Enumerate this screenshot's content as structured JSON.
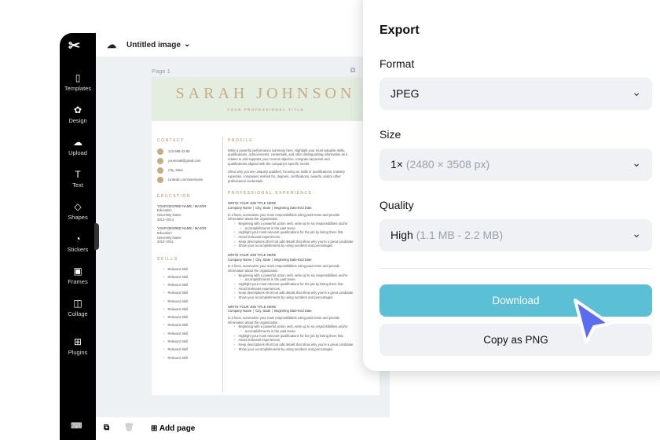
{
  "app": {
    "title": "Untitled image",
    "page_label": "Page 1",
    "add_page": "Add page"
  },
  "sidebar": {
    "items": [
      {
        "label": "Templates",
        "icon": "▯"
      },
      {
        "label": "Design",
        "icon": "✿"
      },
      {
        "label": "Upload",
        "icon": "☁"
      },
      {
        "label": "Text",
        "icon": "T"
      },
      {
        "label": "Shapes",
        "icon": "◇"
      },
      {
        "label": "Stickers",
        "icon": "◔"
      },
      {
        "label": "Frames",
        "icon": "▣"
      },
      {
        "label": "Collage",
        "icon": "◫"
      },
      {
        "label": "Plugins",
        "icon": "⊞"
      }
    ]
  },
  "resume": {
    "name": "SARAH JOHNSON",
    "title": "YOUR PROFESSIONAL TITLE",
    "contact_h": "CONTACT",
    "contact": [
      "123-589-22-88",
      "youremail@gmail.com",
      "City, State",
      "Linkedin.com/username"
    ],
    "education_h": "EDUCATION",
    "education": [
      [
        "YOUR DEGREE NAME / MAJOR",
        "Education",
        "University Name",
        "2012–2014"
      ],
      [
        "YOUR DEGREE NAME / MAJOR",
        "Education",
        "University Name",
        "2010–2011"
      ]
    ],
    "skills_h": "SKILLS",
    "skill": "Relevant Skill",
    "profile_h": "PROFILE",
    "profile": [
      "Write a powerful performance summary here. Highlight your most valuable skills,",
      "qualifications, achievements, credentials, and other distinguishing information as it",
      "relates to and supports your current objective. Integrate keywords and",
      "qualifications aligned with the company's specific needs.",
      "",
      "Show why you are uniquely qualified, focusing on skills or qualifications, industry",
      "expertise, companies worked for, degrees, certifications, awards, and/or other",
      "professional credentials."
    ],
    "exp_h": "PROFESSIONAL EXPERIENCE",
    "job_title": "WRITE YOUR JOB TITLE HERE",
    "job_company": "Company Name │ City, State │ Beginning Date-End Date",
    "job_summary": [
      "In 2 lines, summarize your main responsibilities using past tense and provide",
      "information about the organization."
    ],
    "job_bullets": [
      "Beginning with a powerful action verb, write up to six responsibilities and/or",
      "accomplishments in the past tense.",
      "Highlight your most relevant qualifications for the job by listing them first.",
      "Avoid irrelevant experiences.",
      "Keep descriptions short but add details that show why you're a great candidate.",
      "Show your accomplishments by using numbers and percentages."
    ]
  },
  "export": {
    "title": "Export",
    "format_label": "Format",
    "format_value": "JPEG",
    "size_label": "Size",
    "size_value": "1×",
    "size_detail": "(2480 × 3508 px)",
    "quality_label": "Quality",
    "quality_value": "High",
    "quality_detail": "(1.1 MB - 2.2 MB)",
    "download": "Download",
    "copy": "Copy as PNG"
  },
  "colors": {
    "accent": "#5bbfd6",
    "cursor": "#5b6cf0",
    "gold": "#c8ab80"
  }
}
